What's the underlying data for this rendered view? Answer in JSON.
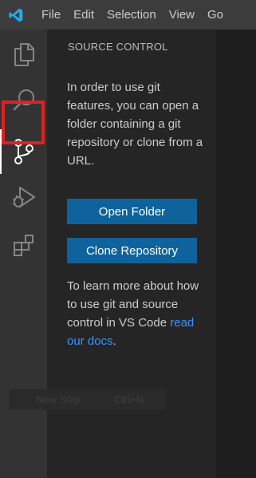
{
  "titlebar": {
    "logo_icon": "vscode-logo-icon",
    "menu": [
      "File",
      "Edit",
      "Selection",
      "View",
      "Go"
    ]
  },
  "activity_bar": {
    "items": [
      {
        "icon": "explorer-icon"
      },
      {
        "icon": "search-icon"
      },
      {
        "icon": "source-control-icon",
        "active": true
      },
      {
        "icon": "run-debug-icon"
      },
      {
        "icon": "extensions-icon"
      }
    ],
    "highlight_color": "#e02020"
  },
  "sidebar": {
    "title": "SOURCE CONTROL",
    "info": "In order to use git features, you can open a folder containing a git repository or clone from a URL.",
    "open_folder": "Open Folder",
    "clone_repo": "Clone Repository",
    "learn_prefix": "To learn more about how to use git and source control in VS Code ",
    "learn_link": "read our docs",
    "learn_suffix": "."
  },
  "ghost_hint": {
    "label": "New Snip",
    "shortcut": "Ctrl+N"
  },
  "colors": {
    "accent_button": "#0e639c",
    "link": "#3794ff",
    "titlebar": "#3c3c3c",
    "activity_bar": "#333333",
    "sidebar": "#252526"
  }
}
